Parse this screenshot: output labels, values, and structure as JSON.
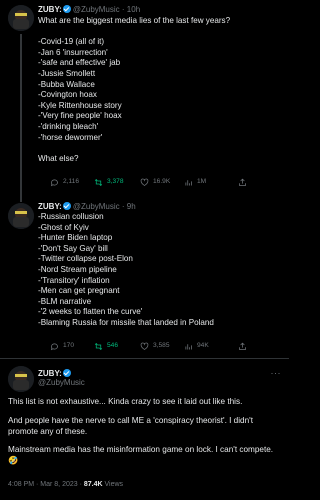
{
  "tweets": [
    {
      "name": "ZUBY:",
      "handle": "@ZubyMusic",
      "time": "10h",
      "text": "What are the biggest media lies of the last few years?\n\n-Covid-19 (all of it)\n-Jan 6 'insurrection'\n-'safe and effective' jab\n-Jussie Smollett\n-Bubba Wallace\n-Covington hoax\n-Kyle Rittenhouse story\n-'Very fine people' hoax\n-'drinking bleach'\n-'horse dewormer'\n\nWhat else?",
      "stats": {
        "replies": "2,116",
        "retweets": "3,378",
        "likes": "16.9K",
        "views": "1M"
      }
    },
    {
      "name": "ZUBY:",
      "handle": "@ZubyMusic",
      "time": "9h",
      "text": "-Russian collusion\n-Ghost of Kyiv\n-Hunter Biden laptop\n-'Don't Say Gay' bill\n-Twitter collapse post-Elon\n-Nord Stream pipeline\n-'Transitory' inflation\n-Men can get pregnant\n-BLM narrative\n-'2 weeks to flatten the curve'\n-Blaming Russia for missile that landed in Poland",
      "stats": {
        "replies": "170",
        "retweets": "546",
        "likes": "3,585",
        "views": "94K"
      }
    },
    {
      "name": "ZUBY:",
      "handle": "@ZubyMusic",
      "paragraphs": [
        "This list is not exhaustive... Kinda crazy to see it laid out like this.",
        "And people have the nerve to call ME a 'conspiracy theorist'. I didn't promote any of these.",
        "Mainstream media has the misinformation game on lock. I can't compete. 🤣"
      ],
      "timestamp": "4:08 PM · Mar 8, 2023 · ",
      "views_count": "87.4K",
      "views_label": " Views"
    }
  ],
  "separator": "·",
  "more_label": "···",
  "icons": {
    "reply": "reply-icon",
    "retweet": "retweet-icon",
    "like": "heart-icon",
    "views": "views-icon",
    "share": "share-icon"
  },
  "colors": {
    "accent": "#1d9bf0",
    "retweet": "#00ba7c",
    "muted": "#71767b"
  }
}
